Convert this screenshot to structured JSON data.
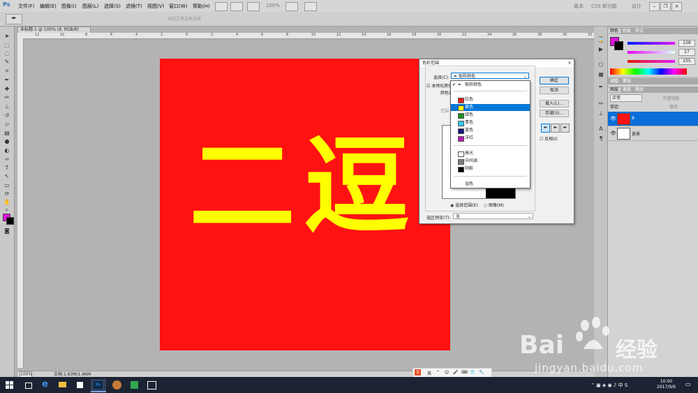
{
  "menubar": {
    "logo": "Ps",
    "items": [
      "文件(F)",
      "编辑(E)",
      "图像(I)",
      "图层(L)",
      "选择(S)",
      "滤镜(T)",
      "视图(V)",
      "窗口(W)",
      "帮助(H)"
    ],
    "zoom": "100%",
    "workspaces": [
      "基本",
      "CS5 新功能",
      "设计"
    ]
  },
  "optbar": {
    "hint": "当前工具没有选项"
  },
  "document": {
    "tab_title": "未标题-1 @ 100% (8, RGB/8)",
    "ruler_ticks": [
      "12",
      "10",
      "8",
      "6",
      "4",
      "2",
      "0",
      "2",
      "4",
      "6",
      "8",
      "10",
      "12",
      "14",
      "16",
      "18",
      "20",
      "22",
      "24",
      "26",
      "28",
      "30",
      "32"
    ],
    "canvas_text": "二逗",
    "colors": {
      "background": "#ff1212",
      "text": "#ffff00"
    }
  },
  "status": {
    "zoom": "100%",
    "doc_info": "文档:1.83M/1.96M"
  },
  "color_panel": {
    "tabs": [
      "颜色",
      "色板",
      "样式"
    ],
    "values": [
      "228",
      "27",
      "255"
    ],
    "foreground": "#e010e0",
    "background": "#000000"
  },
  "adjust_panel": {
    "tabs": [
      "调整",
      "蒙版"
    ]
  },
  "layers_panel": {
    "tabs": [
      "图层",
      "通道",
      "路径"
    ],
    "blend_mode": "正常",
    "opacity_label": "不透明度:",
    "lock_label": "锁定:",
    "fill_label": "填充:",
    "layers": [
      {
        "name": "8",
        "selected": true
      },
      {
        "name": "背景",
        "selected": false
      }
    ]
  },
  "dialog": {
    "title": "色彩范围",
    "close": "×",
    "select_label": "选择(C):",
    "select_value": "取样颜色",
    "localized_label": "本地化颜色簇",
    "fuzziness_label": "颜色容差",
    "range_label": "范围",
    "buttons": {
      "ok": "确定",
      "cancel": "取消",
      "load": "载入(L)...",
      "save": "存储(S)..."
    },
    "invert_label": "反相(I)",
    "radio_selection": "选择范围(E)",
    "radio_image": "图像(M)",
    "preview_label": "选区预览(T):",
    "preview_value": "无"
  },
  "dropdown": {
    "items": [
      {
        "label": "取样颜色",
        "color": null,
        "check": "✔"
      },
      {
        "label": "红色",
        "color": "#e02020"
      },
      {
        "label": "黄色",
        "color": "#ffff00",
        "selected": true
      },
      {
        "label": "绿色",
        "color": "#1f8f1f"
      },
      {
        "label": "青色",
        "color": "#30c8e8"
      },
      {
        "label": "蓝色",
        "color": "#14147a"
      },
      {
        "label": "洋红",
        "color": "#b01cb0"
      },
      {
        "label": "高光",
        "color": "#ffffff"
      },
      {
        "label": "中间调",
        "color": "#808080"
      },
      {
        "label": "阴影",
        "color": "#000000"
      },
      {
        "label": "溢色",
        "color": null
      }
    ]
  },
  "ime": {
    "lang": "英"
  },
  "taskbar": {
    "time": "10:00",
    "date": "2017/9/6"
  },
  "watermark": {
    "brand": "Bai",
    "brand2": "经验",
    "url": "jingyan.baidu.com"
  }
}
